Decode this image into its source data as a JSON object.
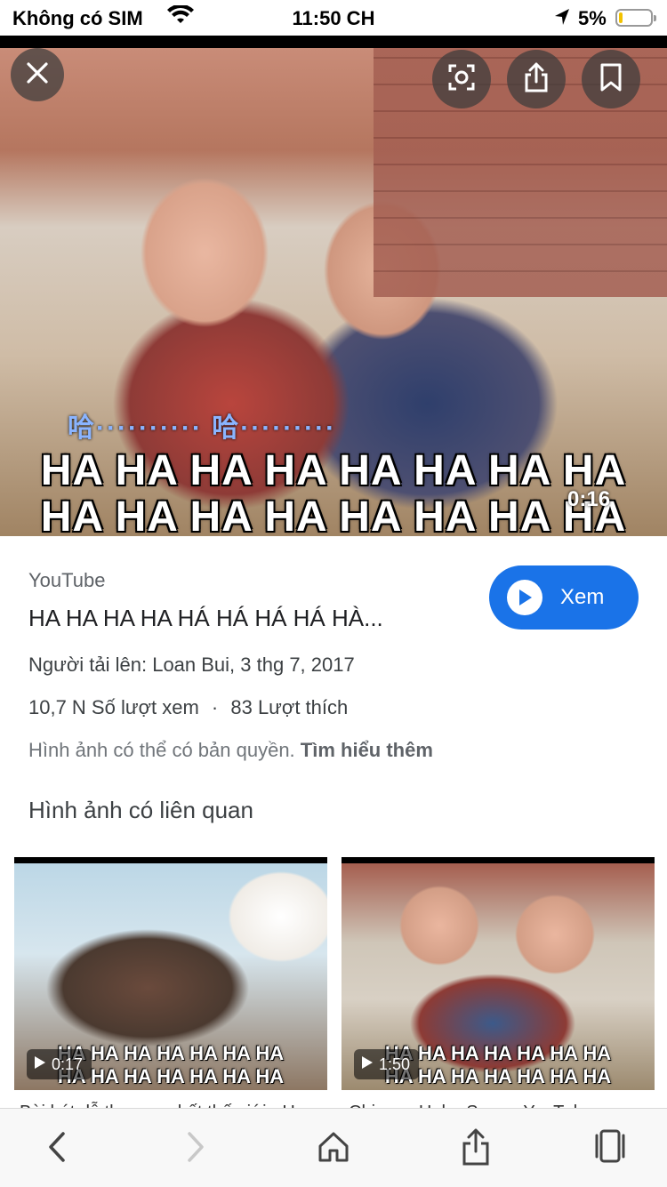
{
  "status_bar": {
    "carrier": "Không có SIM",
    "time": "11:50 CH",
    "battery_text": "5%"
  },
  "viewer": {
    "lyric_line_1": "HA HA HA HA HA HA HA HA",
    "lyric_line_2": "HA HA HA HA HA HA HA HA",
    "lyric_notes": "哈·········· 哈·········",
    "duration": "0:16",
    "icons": [
      "close-icon",
      "lens-icon",
      "share-icon",
      "bookmark-icon"
    ]
  },
  "result": {
    "source": "YouTube",
    "title": "HA HA HA HA HÁ HÁ HÁ HÁ HÀ...",
    "uploader": "Người tải lên: Loan Bui, 3 thg 7, 2017",
    "views": "10,7 N Số lượt xem",
    "separator": "·",
    "likes": "83 Lượt thích",
    "copyright_text": "Hình ảnh có thể có bản quyền.",
    "learn_more": "Tìm hiểu thêm",
    "watch_label": "Xem",
    "accent_color": "#1a73e8"
  },
  "related": {
    "heading": "Hình ảnh có liên quan",
    "items": [
      {
        "duration": "0:17",
        "lyric_a": "HA HA HA HA HA HA HA",
        "lyric_b": "HA HA HA HA HA HA HA",
        "caption": "Bài hát dễ thương nhất thế giới - Ha..."
      },
      {
        "duration": "1:50",
        "lyric_a": "HA HA HA HA HA HA HA",
        "lyric_b": "HA HA HA HA HA HA HA",
        "caption": "Chinese Haha Song - YouTube"
      }
    ]
  },
  "toolbar": {
    "icons": [
      "back-icon",
      "forward-icon",
      "home-icon",
      "share-icon",
      "tabs-icon"
    ]
  }
}
